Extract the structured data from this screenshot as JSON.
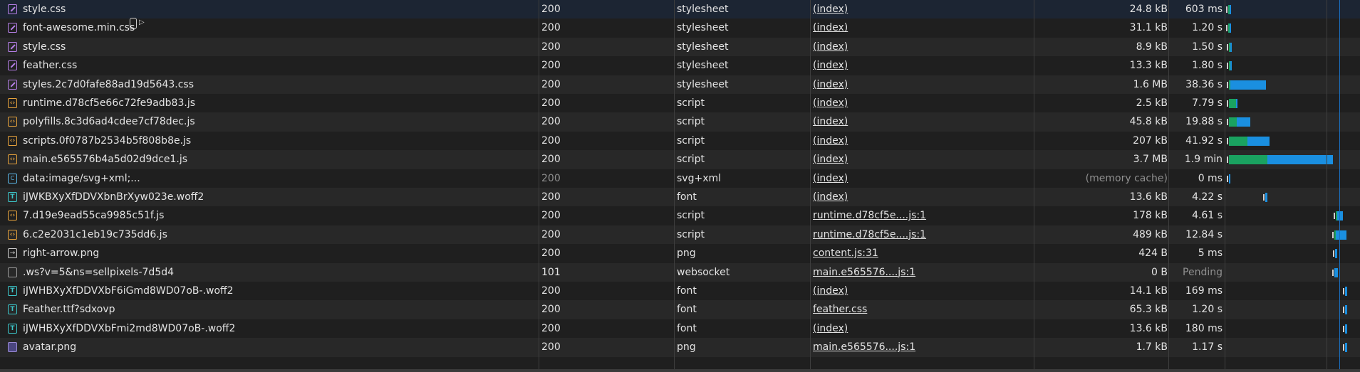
{
  "requests": [
    {
      "name": "style.css",
      "icon": "stylesheet-icon",
      "status": "200",
      "type": "stylesheet",
      "initiator": "(index)",
      "size": "24.8 kB",
      "time": "603 ms"
    },
    {
      "name": "font-awesome.min.css",
      "icon": "stylesheet-icon",
      "status": "200",
      "type": "stylesheet",
      "initiator": "(index)",
      "size": "31.1 kB",
      "time": "1.20 s"
    },
    {
      "name": "style.css",
      "icon": "stylesheet-icon",
      "status": "200",
      "type": "stylesheet",
      "initiator": "(index)",
      "size": "8.9 kB",
      "time": "1.50 s"
    },
    {
      "name": "feather.css",
      "icon": "stylesheet-icon",
      "status": "200",
      "type": "stylesheet",
      "initiator": "(index)",
      "size": "13.3 kB",
      "time": "1.80 s"
    },
    {
      "name": "styles.2c7d0fafe88ad19d5643.css",
      "icon": "stylesheet-icon",
      "status": "200",
      "type": "stylesheet",
      "initiator": "(index)",
      "size": "1.6 MB",
      "time": "38.36 s"
    },
    {
      "name": "runtime.d78cf5e66c72fe9adb83.js",
      "icon": "script-icon",
      "status": "200",
      "type": "script",
      "initiator": "(index)",
      "size": "2.5 kB",
      "time": "7.79 s"
    },
    {
      "name": "polyfills.8c3d6ad4cdee7cf78dec.js",
      "icon": "script-icon",
      "status": "200",
      "type": "script",
      "initiator": "(index)",
      "size": "45.8 kB",
      "time": "19.88 s"
    },
    {
      "name": "scripts.0f0787b2534b5f808b8e.js",
      "icon": "script-icon",
      "status": "200",
      "type": "script",
      "initiator": "(index)",
      "size": "207 kB",
      "time": "41.92 s"
    },
    {
      "name": "main.e565576b4a5d02d9dce1.js",
      "icon": "script-icon",
      "status": "200",
      "type": "script",
      "initiator": "(index)",
      "size": "3.7 MB",
      "time": "1.9 min"
    },
    {
      "name": "data:image/svg+xml;...",
      "icon": "svg-icon",
      "status": "200",
      "type": "svg+xml",
      "initiator": "(index)",
      "size": "(memory cache)",
      "time": "0 ms",
      "dim": true
    },
    {
      "name": "iJWKBXyXfDDVXbnBrXyw023e.woff2",
      "icon": "font-icon",
      "status": "200",
      "type": "font",
      "initiator": "(index)",
      "size": "13.6 kB",
      "time": "4.22 s"
    },
    {
      "name": "7.d19e9ead55ca9985c51f.js",
      "icon": "script-icon",
      "status": "200",
      "type": "script",
      "initiator": "runtime.d78cf5e....js:1",
      "size": "178 kB",
      "time": "4.61 s"
    },
    {
      "name": "6.c2e2031c1eb19c735dd6.js",
      "icon": "script-icon",
      "status": "200",
      "type": "script",
      "initiator": "runtime.d78cf5e....js:1",
      "size": "489 kB",
      "time": "12.84 s"
    },
    {
      "name": "right-arrow.png",
      "icon": "image-icon",
      "status": "200",
      "type": "png",
      "initiator": "content.js:31",
      "size": "424 B",
      "time": "5 ms"
    },
    {
      "name": ".ws?v=5&ns=sellpixels-7d5d4",
      "icon": "socket-icon",
      "status": "101",
      "type": "websocket",
      "initiator": "main.e565576....js:1",
      "size": "0 B",
      "time": "Pending",
      "time_dim": true
    },
    {
      "name": "iJWHBXyXfDDVXbF6iGmd8WD07oB-.woff2",
      "icon": "font-icon",
      "status": "200",
      "type": "font",
      "initiator": "(index)",
      "size": "14.1 kB",
      "time": "169 ms"
    },
    {
      "name": "Feather.ttf?sdxovp",
      "icon": "font-icon",
      "status": "200",
      "type": "font",
      "initiator": "feather.css",
      "size": "65.3 kB",
      "time": "1.20 s"
    },
    {
      "name": "iJWHBXyXfDDVXbFmi2md8WD07oB-.woff2",
      "icon": "font-icon",
      "status": "200",
      "type": "font",
      "initiator": "(index)",
      "size": "13.6 kB",
      "time": "180 ms"
    },
    {
      "name": "avatar.png",
      "icon": "avatar-icon",
      "status": "200",
      "type": "png",
      "initiator": "main.e565576....js:1",
      "size": "1.7 kB",
      "time": "1.17 s"
    }
  ],
  "icon_glyphs": {
    "script-icon": "‹›",
    "svg-icon": "C",
    "font-icon": "T",
    "image-icon": "→"
  },
  "colors": {
    "waiting": "#1aa260",
    "download": "#1a8fe0",
    "selected_row": "#1c2533",
    "stylesheet": "#b57fe6",
    "script": "#e6a23c",
    "font": "#3cc5c9"
  },
  "waterfall": [
    {
      "start": 0.9,
      "wait": 0.3,
      "dl": 0.8
    },
    {
      "start": 1.0,
      "wait": 0.3,
      "dl": 0.8
    },
    {
      "start": 1.1,
      "wait": 0.3,
      "dl": 0.8
    },
    {
      "start": 1.2,
      "wait": 0.4,
      "dl": 0.9
    },
    {
      "start": 1.3,
      "wait": 0.5,
      "dl": 21.0
    },
    {
      "start": 1.3,
      "wait": 4.0,
      "dl": 0.9
    },
    {
      "start": 1.3,
      "wait": 4.5,
      "dl": 8.0
    },
    {
      "start": 1.3,
      "wait": 11.0,
      "dl": 13.0
    },
    {
      "start": 1.3,
      "wait": 23.0,
      "dl": 39.0
    },
    {
      "start": 1.3,
      "wait": 0,
      "dl": 0.8
    },
    {
      "start": 23.0,
      "wait": 0,
      "dl": 1.0
    },
    {
      "start": 65.0,
      "wait": 0.5,
      "dl": 3.0
    },
    {
      "start": 64.0,
      "wait": 0.5,
      "dl": 6.5
    },
    {
      "start": 64.5,
      "wait": 0,
      "dl": 1.0
    },
    {
      "start": 64.0,
      "wait": 0,
      "dl": 2.0
    },
    {
      "start": 70.5,
      "wait": 0,
      "dl": 0.9
    },
    {
      "start": 70.5,
      "wait": 0,
      "dl": 0.9
    },
    {
      "start": 70.5,
      "wait": 0,
      "dl": 0.9
    },
    {
      "start": 70.5,
      "wait": 0,
      "dl": 0.9
    }
  ],
  "waterfall_scale_max": 72
}
